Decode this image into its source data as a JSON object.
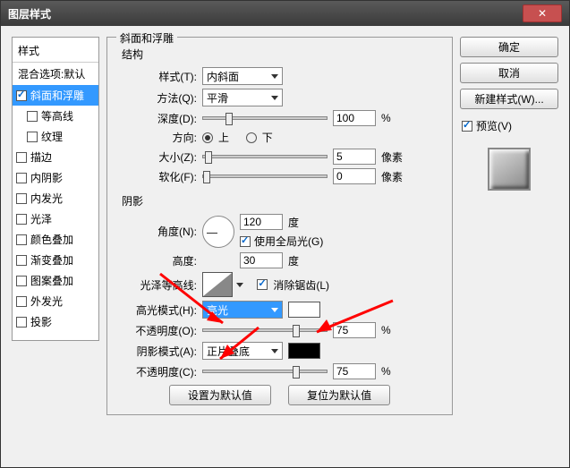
{
  "window": {
    "title": "图层样式"
  },
  "buttons": {
    "ok": "确定",
    "cancel": "取消",
    "new_style": "新建样式(W)...",
    "preview": "预览(V)",
    "reset_default": "设置为默认值",
    "restore_default": "复位为默认值"
  },
  "styles_panel": {
    "title": "样式",
    "blend_options": "混合选项:默认",
    "bevel_emboss": "斜面和浮雕",
    "contour": "等高线",
    "texture": "纹理",
    "stroke": "描边",
    "inner_shadow": "内阴影",
    "inner_glow": "内发光",
    "satin": "光泽",
    "color_overlay": "颜色叠加",
    "gradient_overlay": "渐变叠加",
    "pattern_overlay": "图案叠加",
    "outer_glow": "外发光",
    "drop_shadow": "投影"
  },
  "bevel": {
    "group_title": "斜面和浮雕",
    "structure_title": "结构",
    "style_label": "样式(T):",
    "style_value": "内斜面",
    "technique_label": "方法(Q):",
    "technique_value": "平滑",
    "depth_label": "深度(D):",
    "depth_value": "100",
    "percent": "%",
    "direction_label": "方向:",
    "dir_up": "上",
    "dir_down": "下",
    "size_label": "大小(Z):",
    "size_value": "5",
    "px": "像素",
    "soften_label": "软化(F):",
    "soften_value": "0"
  },
  "shading": {
    "title": "阴影",
    "angle_label": "角度(N):",
    "angle_value": "120",
    "degree": "度",
    "global_light": "使用全局光(G)",
    "altitude_label": "高度:",
    "altitude_value": "30",
    "gloss_contour_label": "光泽等高线:",
    "antialias": "消除锯齿(L)",
    "highlight_mode_label": "高光模式(H):",
    "highlight_mode_value": "亮光",
    "highlight_opacity_label": "不透明度(O):",
    "highlight_opacity_value": "75",
    "shadow_mode_label": "阴影模式(A):",
    "shadow_mode_value": "正片叠底",
    "shadow_opacity_label": "不透明度(C):",
    "shadow_opacity_value": "75"
  }
}
